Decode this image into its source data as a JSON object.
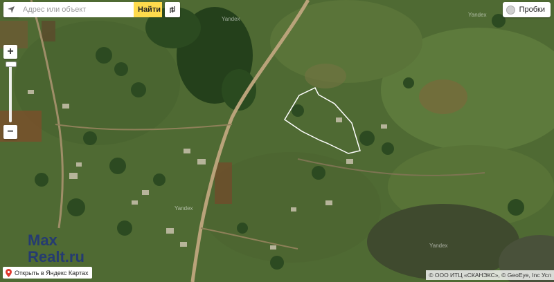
{
  "search": {
    "placeholder": "Адрес или объект",
    "find_label": "Найти"
  },
  "traffic": {
    "label": "Пробки"
  },
  "footer": {
    "open_link": "Открыть в Яндекс Картах",
    "copyright": "© ООО ИТЦ «СКАНЭКС», © GeoEye, Inc Усл"
  },
  "watermark": {
    "line1": "Max",
    "line2": "Realt.ru"
  },
  "map_labels": {
    "yandex": "Yandex"
  },
  "colors": {
    "find_button": "#ffdb4d",
    "plot_outline": "#ffffff",
    "pin": "#e03a2f"
  }
}
